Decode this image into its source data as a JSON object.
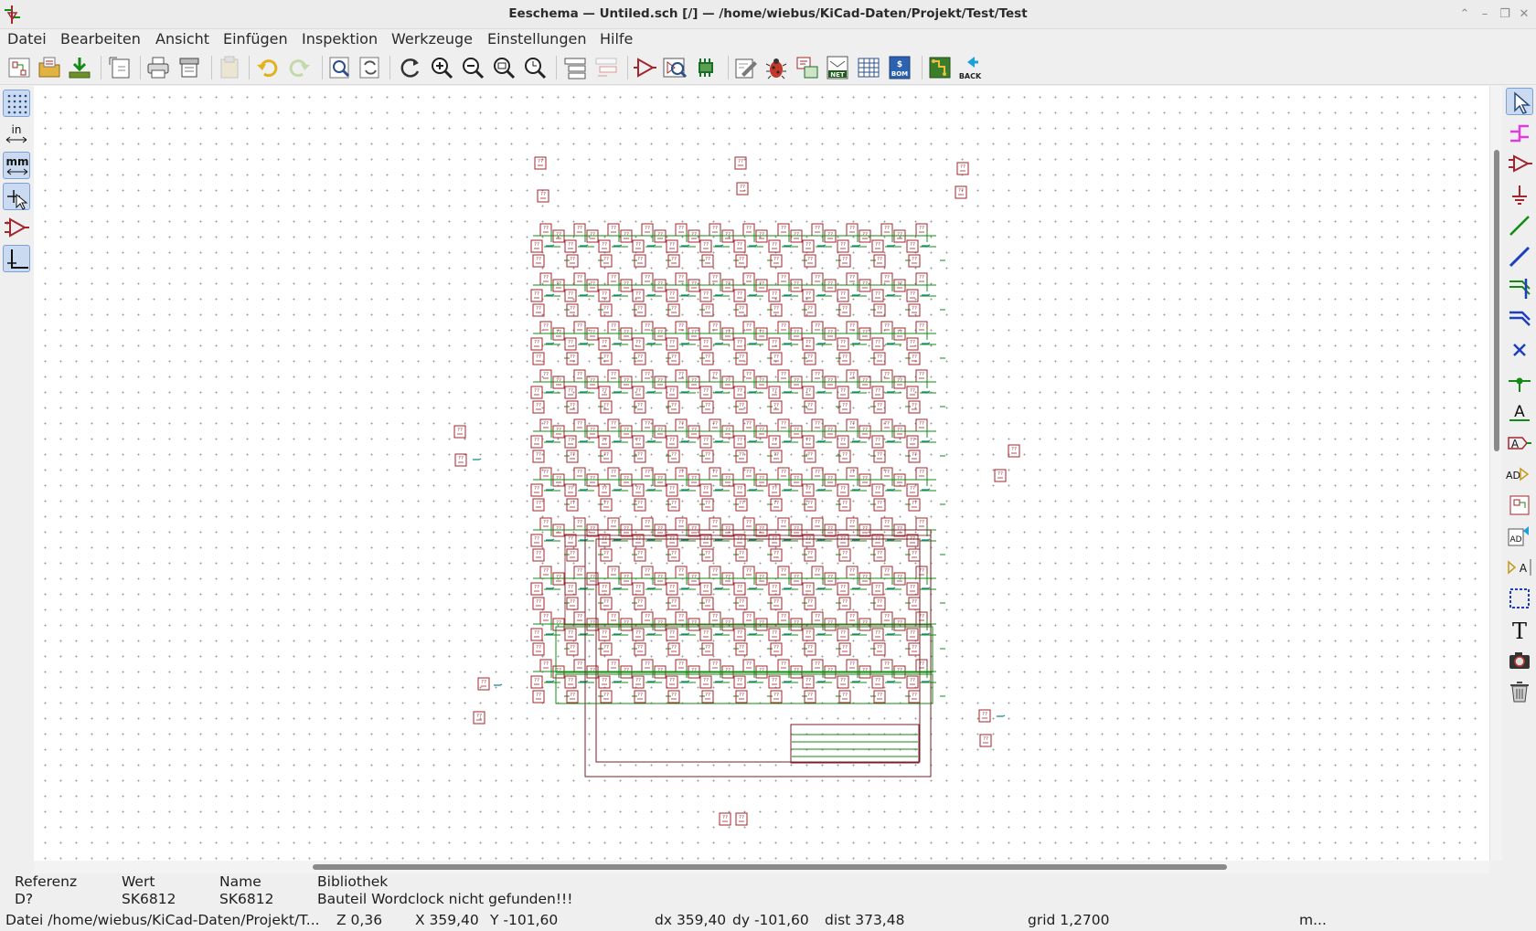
{
  "window": {
    "title": "Eeschema — Untiled.sch [/] — /home/wiebus/KiCad-Daten/Projekt/Test/Test"
  },
  "menu": [
    "Datei",
    "Bearbeiten",
    "Ansicht",
    "Einfügen",
    "Inspektion",
    "Werkzeuge",
    "Einstellungen",
    "Hilfe"
  ],
  "toolbar": {
    "icons": [
      "schematic-setup-icon",
      "open-icon",
      "save-icon",
      "page-settings-icon",
      "print-icon",
      "plot-icon",
      "paste-icon",
      "undo-icon",
      "redo-icon",
      "find-icon",
      "find-replace-icon",
      "refresh-icon",
      "zoom-in-icon",
      "zoom-out-icon",
      "zoom-fit-icon",
      "zoom-selection-icon",
      "hierarchy-navigator-icon",
      "leave-sheet-icon",
      "symbol-editor-icon",
      "symbol-browser-icon",
      "footprint-editor-icon",
      "annotate-icon",
      "erc-icon",
      "assign-footprints-icon",
      "netlist-icon",
      "field-editor-icon",
      "bom-icon",
      "pcbnew-icon",
      "back-annotate-icon"
    ],
    "net_label": "NET",
    "bom_label": "BOM",
    "back_label": "BACK"
  },
  "left_toolbar": {
    "in_label": "in",
    "mm_label": "mm",
    "items": [
      "grid-icon",
      "inch-units-icon",
      "mm-units-icon",
      "cursor-shape-icon",
      "hidden-pins-icon",
      "wire-angle-icon"
    ]
  },
  "right_toolbar": {
    "items": [
      "select-arrow-icon",
      "highlight-net-icon",
      "add-symbol-icon",
      "add-power-icon",
      "add-wire-icon",
      "add-bus-icon",
      "wire-bus-entry-icon",
      "bus-bus-entry-icon",
      "no-connect-icon",
      "junction-icon",
      "net-label-icon",
      "global-label-icon",
      "hierarchical-label-icon",
      "hierarchical-sheet-icon",
      "import-sheet-pin-icon",
      "add-sheet-pin-icon",
      "graphic-lines-icon",
      "graphic-text-icon",
      "add-image-icon",
      "delete-icon"
    ],
    "text_label": "T",
    "label_a": "A"
  },
  "message_panel": {
    "headers": [
      "Referenz",
      "Wert",
      "Name",
      "Bibliothek"
    ],
    "values": [
      "D?",
      "SK6812",
      "SK6812",
      "Bauteil Wordclock nicht gefunden!!!"
    ]
  },
  "status_bar": {
    "file": "Datei /home/wiebus/KiCad-Daten/Projekt/T...",
    "zoom": "Z 0,36",
    "x": "X 359,40",
    "y": "Y -101,60",
    "dx": "dx 359,40",
    "dy": "dy -101,60",
    "dist": "dist 373,48",
    "grid": "grid 1,2700",
    "units": "m..."
  },
  "schematic": {
    "component_ref": "??",
    "colors": {
      "component": "#a3262e",
      "wire": "#138a13",
      "label": "#128c8c",
      "grid_dot": "#9a9a9a",
      "sheet": "#7a1f24"
    }
  }
}
